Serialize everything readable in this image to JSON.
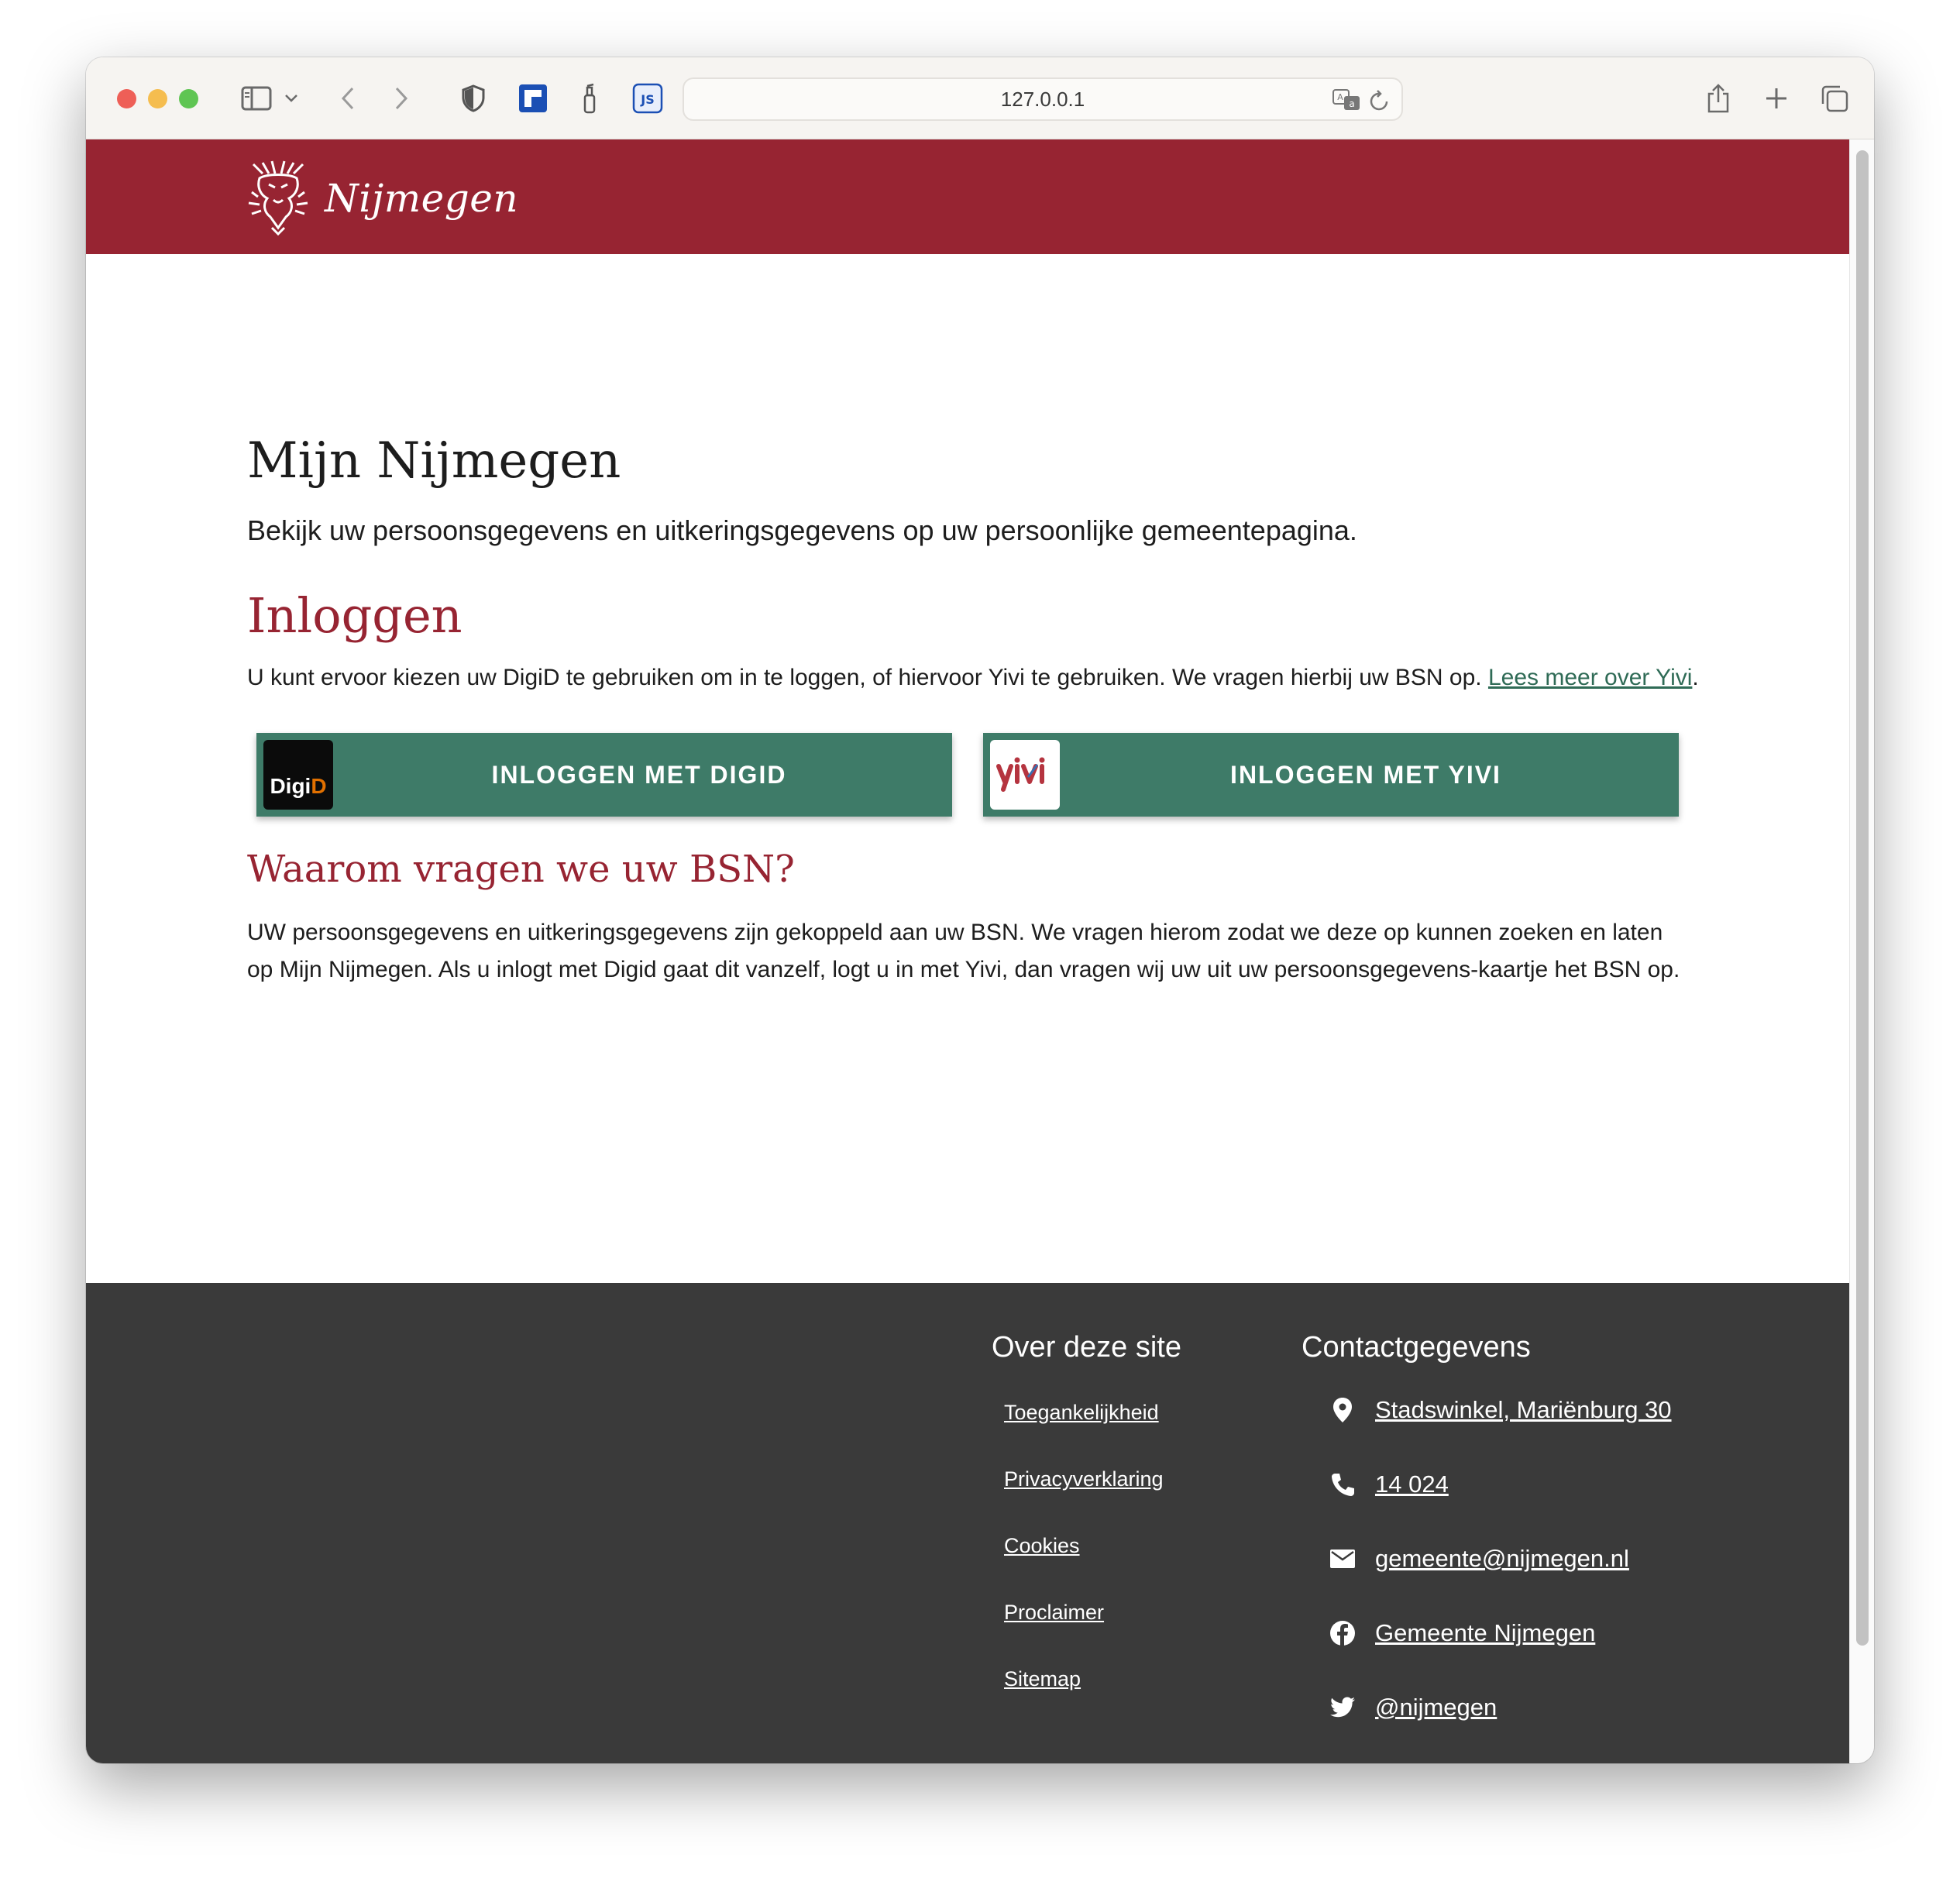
{
  "browser": {
    "url": "127.0.0.1"
  },
  "header": {
    "logo_text": "Nijmegen"
  },
  "main": {
    "title": "Mijn Nijmegen",
    "intro": "Bekijk uw persoonsgegevens en uitkeringsgegevens op uw persoonlijke gemeentepagina.",
    "login_heading": "Inloggen",
    "login_text": "U kunt ervoor kiezen uw DigiD te gebruiken om in te loggen, of hiervoor Yivi te gebruiken. We vragen hierbij uw BSN op. ",
    "login_link": "Lees meer over Yivi",
    "login_text_end": ".",
    "digid_button": "INLOGGEN MET DIGID",
    "digid_logo_a": "Digi",
    "digid_logo_b": "D",
    "yivi_button": "INLOGGEN MET YIVI",
    "bsn_heading": "Waarom vragen we uw BSN?",
    "bsn_text": "UW persoonsgegevens en uitkeringsgegevens zijn gekoppeld aan uw BSN. We vragen hierom zodat we deze op kunnen zoeken en laten op Mijn Nijmegen. Als u inlogt met Digid gaat dit vanzelf, logt u in met Yivi, dan vragen wij uw uit uw persoonsgegevens-kaartje het BSN op."
  },
  "footer": {
    "about_heading": "Over deze site",
    "about_links": [
      "Toegankelijkheid",
      "Privacyverklaring",
      "Cookies",
      "Proclaimer",
      "Sitemap"
    ],
    "contact_heading": "Contactgegevens",
    "contact": [
      {
        "icon": "location-icon",
        "label": "Stadswinkel, Mariënburg 30"
      },
      {
        "icon": "phone-icon",
        "label": "14 024"
      },
      {
        "icon": "mail-icon",
        "label": "gemeente@nijmegen.nl"
      },
      {
        "icon": "facebook-icon",
        "label": "Gemeente Nijmegen"
      },
      {
        "icon": "twitter-icon",
        "label": "@nijmegen"
      }
    ]
  },
  "colors": {
    "brand_red": "#972432",
    "button_green": "#3e7b68",
    "link_green": "#2f6b56",
    "footer_bg": "#3a3a3a"
  }
}
